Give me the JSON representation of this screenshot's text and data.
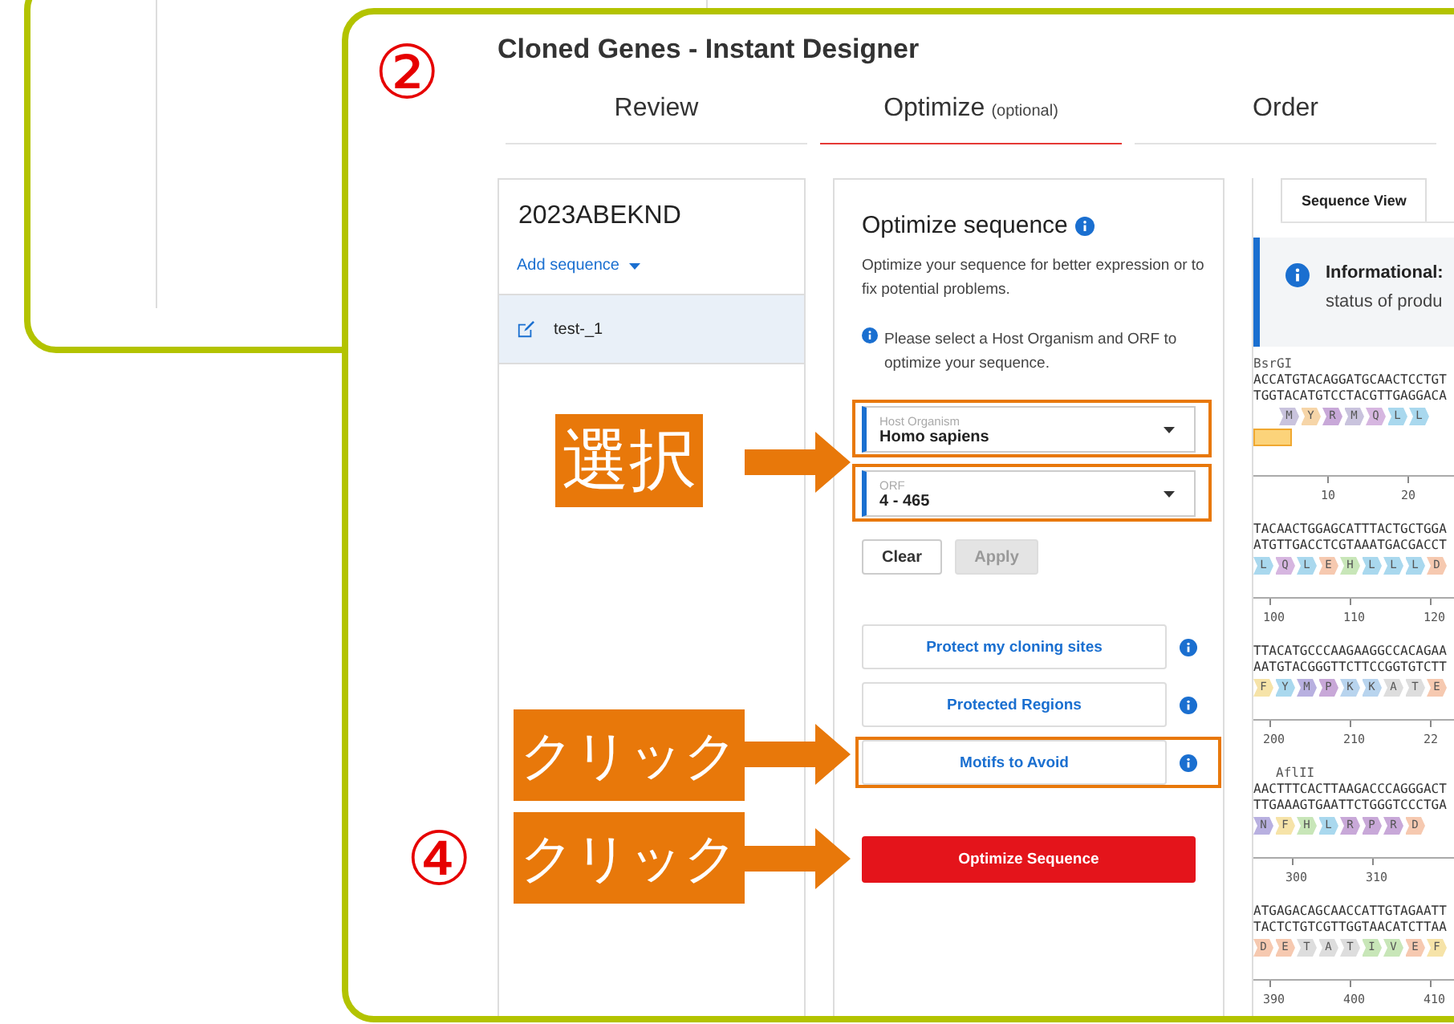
{
  "window": {
    "step": "②",
    "title": "Cloned Genes - Instant Designer"
  },
  "tabs": [
    {
      "label": "Review",
      "selected": false
    },
    {
      "label": "Optimize",
      "note": "(optional)",
      "selected": true
    },
    {
      "label": "Order",
      "selected": false
    }
  ],
  "sequence_list": {
    "name": "2023ABEKND",
    "add_link": "Add sequence",
    "items": [
      {
        "label": "test-_1",
        "selected": true
      }
    ]
  },
  "optimize": {
    "heading": "Optimize sequence",
    "description": "Optimize your sequence for better expression or to fix potential problems.",
    "notice": "Please select a Host Organism and ORF to optimize your sequence.",
    "selects": [
      {
        "label": "Host Organism",
        "value": "Homo sapiens",
        "highlighted": true
      },
      {
        "label": "ORF",
        "value": "4 - 465",
        "highlighted": true
      }
    ],
    "buttons": [
      {
        "label": "Clear",
        "disabled": false
      },
      {
        "label": "Apply",
        "disabled": true
      }
    ],
    "options": [
      {
        "label": "Protect my cloning sites",
        "highlighted": false
      },
      {
        "label": "Protected Regions",
        "highlighted": false
      },
      {
        "label": "Motifs to Avoid",
        "highlighted": true
      }
    ],
    "submit": "Optimize Sequence"
  },
  "sequence_view": {
    "tabs": [
      {
        "label": "Sequence View",
        "selected": true
      }
    ],
    "info_title": "Informational:",
    "info_text": "status of produ",
    "blocks": [
      {
        "site": "BsrGI",
        "top": "ACCATGTACAGGATGCAACTCCTGT",
        "bottom": "TGGTACATGTCCTACGTTGAGGACA",
        "feature": true,
        "aminos": [
          {
            "letter": "M",
            "color": "#c9c3dd"
          },
          {
            "letter": "Y",
            "color": "#f6d5a8"
          },
          {
            "letter": "R",
            "color": "#c8a8d8"
          },
          {
            "letter": "M",
            "color": "#c9c3dd"
          },
          {
            "letter": "Q",
            "color": "#d6b6e0"
          },
          {
            "letter": "L",
            "color": "#a9d8ee"
          },
          {
            "letter": "L",
            "color": "#a9d8ee"
          }
        ],
        "ticks": [
          "10",
          "20"
        ]
      },
      {
        "top": "TACAACTGGAGCATTTACTGCTGGA",
        "bottom": "ATGTTGACCTCGTAAATGACGACCT",
        "aminos": [
          {
            "letter": "L",
            "color": "#a9d8ee"
          },
          {
            "letter": "Q",
            "color": "#d6b6e0"
          },
          {
            "letter": "L",
            "color": "#a9d8ee"
          },
          {
            "letter": "E",
            "color": "#f6c9b0"
          },
          {
            "letter": "H",
            "color": "#c8e6b8"
          },
          {
            "letter": "L",
            "color": "#a9d8ee"
          },
          {
            "letter": "L",
            "color": "#a9d8ee"
          },
          {
            "letter": "L",
            "color": "#a9d8ee"
          },
          {
            "letter": "D",
            "color": "#f6c9b0"
          }
        ],
        "ticks": [
          "100",
          "110",
          "120"
        ]
      },
      {
        "top": "TTACATGCCCAAGAAGGCCACAGAA",
        "bottom": "AATGTACGGGTTCTTCCGGTGTCTT",
        "aminos": [
          {
            "letter": "F",
            "color": "#f6e3a8"
          },
          {
            "letter": "Y",
            "color": "#a9d8ee"
          },
          {
            "letter": "M",
            "color": "#b8b0e0"
          },
          {
            "letter": "P",
            "color": "#c8a8d8"
          },
          {
            "letter": "K",
            "color": "#b8d4ee"
          },
          {
            "letter": "K",
            "color": "#b8d4ee"
          },
          {
            "letter": "A",
            "color": "#dddddd"
          },
          {
            "letter": "T",
            "color": "#dddddd"
          },
          {
            "letter": "E",
            "color": "#f6c9b0"
          }
        ],
        "ticks": [
          "200",
          "210",
          "22"
        ]
      },
      {
        "site": "AflII",
        "top": "AACTTTCACTTAAGACCCAGGGACT",
        "bottom": "TTGAAAGTGAATTCTGGGTCCCTGA",
        "aminos": [
          {
            "letter": "N",
            "color": "#b8b0e0"
          },
          {
            "letter": "F",
            "color": "#f6e3a8"
          },
          {
            "letter": "H",
            "color": "#c8e6b8"
          },
          {
            "letter": "L",
            "color": "#a9d8ee"
          },
          {
            "letter": "R",
            "color": "#c8a8d8"
          },
          {
            "letter": "P",
            "color": "#c8a8d8"
          },
          {
            "letter": "R",
            "color": "#c8a8d8"
          },
          {
            "letter": "D",
            "color": "#f6c9b0"
          }
        ],
        "ticks": [
          "300",
          "310"
        ]
      },
      {
        "top": "ATGAGACAGCAACCATTGTAGAATT",
        "bottom": "TACTCTGTCGTTGGTAACATCTTAA",
        "aminos": [
          {
            "letter": "D",
            "color": "#f6c9b0"
          },
          {
            "letter": "E",
            "color": "#f6c9b0"
          },
          {
            "letter": "T",
            "color": "#dddddd"
          },
          {
            "letter": "A",
            "color": "#dddddd"
          },
          {
            "letter": "T",
            "color": "#dddddd"
          },
          {
            "letter": "I",
            "color": "#c8e6b8"
          },
          {
            "letter": "V",
            "color": "#c8e6b8"
          },
          {
            "letter": "E",
            "color": "#f6c9b0"
          },
          {
            "letter": "F",
            "color": "#f6e3a8"
          }
        ],
        "ticks": [
          "390",
          "400",
          "410"
        ]
      }
    ]
  },
  "annotations": [
    {
      "kind": "label",
      "text": "選択"
    },
    {
      "kind": "label",
      "text": "クリック"
    },
    {
      "kind": "step",
      "step": "④",
      "text": "クリック"
    }
  ]
}
